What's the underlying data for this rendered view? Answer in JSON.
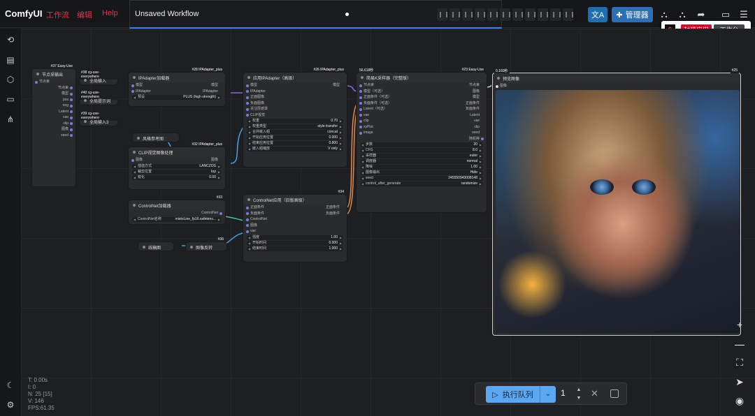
{
  "app": {
    "brand": "ComfyUI"
  },
  "menu": [
    {
      "label": "工作流"
    },
    {
      "label": "编辑"
    },
    {
      "label": "Help"
    }
  ],
  "workflow_tab": {
    "title": "Unsaved Workflow"
  },
  "toolbar": {
    "manager_label": "管理器",
    "translate_icon": "translate-icon"
  },
  "package_popup": {
    "logo": "S",
    "package_label": "封装应用",
    "workbench_label": "工作台"
  },
  "nodes": {
    "n37": {
      "badge": "#37 Easy-Use",
      "title": "节点采输出",
      "rows": [
        "节点束",
        "模型",
        "pos",
        "neg",
        "Latent",
        "vae",
        "clip",
        "图像",
        "seed"
      ],
      "inputs": [
        "节点束"
      ]
    },
    "n38": {
      "badge": "#38 cg-use-everywhere",
      "title": "全局输入"
    },
    "n40": {
      "badge": "#40 cg-use-everywhere",
      "title": "全局提示词"
    },
    "n39": {
      "badge": "#39 cg-use-everywhere",
      "title": "全局输入3"
    },
    "n28": {
      "badge": "#28 IPAdapter_plus",
      "title": "IPAdapter加载器",
      "in1": "模型",
      "in2": "IPAdapter",
      "out1": "模型",
      "out2": "IPAdapter",
      "w_label": "预设",
      "w_value": "PLUS (high strength)"
    },
    "ref": {
      "title": "风格参考图"
    },
    "n32": {
      "badge": "#32 IPAdapter_plus",
      "title": "CLIP视觉图像处理",
      "in1": "图像",
      "out1": "图像",
      "widgets": [
        {
          "label": "插值方式",
          "value": "LANCZOS"
        },
        {
          "label": "裁剪位置",
          "value": "top"
        },
        {
          "label": "锐化",
          "value": "0.00"
        }
      ]
    },
    "n26": {
      "badge": "#26 IPAdapter_plus",
      "title": "应用IPAdapter（高级）",
      "inputs": [
        "模型",
        "IPAdapter",
        "正面图像",
        "负面图像",
        "关注层遮罩",
        "CLIP视觉"
      ],
      "out1": "模型",
      "widgets": [
        {
          "label": "权重",
          "value": "0.70"
        },
        {
          "label": "权重类型",
          "value": "style transfer"
        },
        {
          "label": "合并嵌入组",
          "value": "concat"
        },
        {
          "label": "开始应用位置",
          "value": "0.000"
        },
        {
          "label": "结束应用位置",
          "value": "0.800"
        },
        {
          "label": "嵌入组缩放",
          "value": "V only"
        }
      ]
    },
    "n33": {
      "badge": "#33",
      "title": "ControlNet加载器",
      "out1": "ControlNet",
      "w_label": "ControlNet名称",
      "w_value": "mistoLine_fp16.safetens..."
    },
    "n36": {
      "badge": "#36",
      "src_title": "线稿图",
      "title": "图像反转"
    },
    "n34": {
      "badge": "#34",
      "title": "ControlNet应用（旧版高级）",
      "inputs": [
        "正面条件",
        "负面条件",
        "ControlNet",
        "图像",
        "vae"
      ],
      "outputs": [
        "正面条件",
        "负面条件"
      ],
      "widgets": [
        {
          "label": "强度",
          "value": "1.00"
        },
        {
          "label": "开始时间",
          "value": "0.000"
        },
        {
          "label": "结束时间",
          "value": "1.000"
        }
      ]
    },
    "n23": {
      "badge": "#23 Easy-Use",
      "time": "56.618秒",
      "title": "简易K采样器（完整版）",
      "inputs": [
        "节点束",
        "模型（可选）",
        "正面条件（可选）",
        "负面条件（可选）",
        "Latent（可选）",
        "vae",
        "clip",
        "xyPlot",
        "image"
      ],
      "outputs": [
        "节点束",
        "图像",
        "模型",
        "正面条件",
        "负面条件",
        "Latent",
        "vae",
        "clip",
        "seed",
        "随机种"
      ],
      "widgets": [
        {
          "label": "步数",
          "value": "20"
        },
        {
          "label": "CFG",
          "value": "8.0"
        },
        {
          "label": "采样器",
          "value": "euler"
        },
        {
          "label": "调度器",
          "value": "normal"
        },
        {
          "label": "降噪",
          "value": "1.00"
        },
        {
          "label": "图像输出",
          "value": "Hide"
        },
        {
          "label": "seed",
          "value": "245550943008148"
        },
        {
          "label": "control_after_generate",
          "value": "randomize"
        }
      ]
    },
    "n25": {
      "badge": "#25",
      "time": "0.160秒",
      "title": "预览图像",
      "in1": "图像"
    }
  },
  "status": {
    "t": "T: 0.00s",
    "i": "I: 0",
    "n": "N: 25 [15]",
    "v": "V: 146",
    "fps": "FPS:61.35"
  },
  "queue": {
    "run_label": "执行队列",
    "count": "1"
  }
}
